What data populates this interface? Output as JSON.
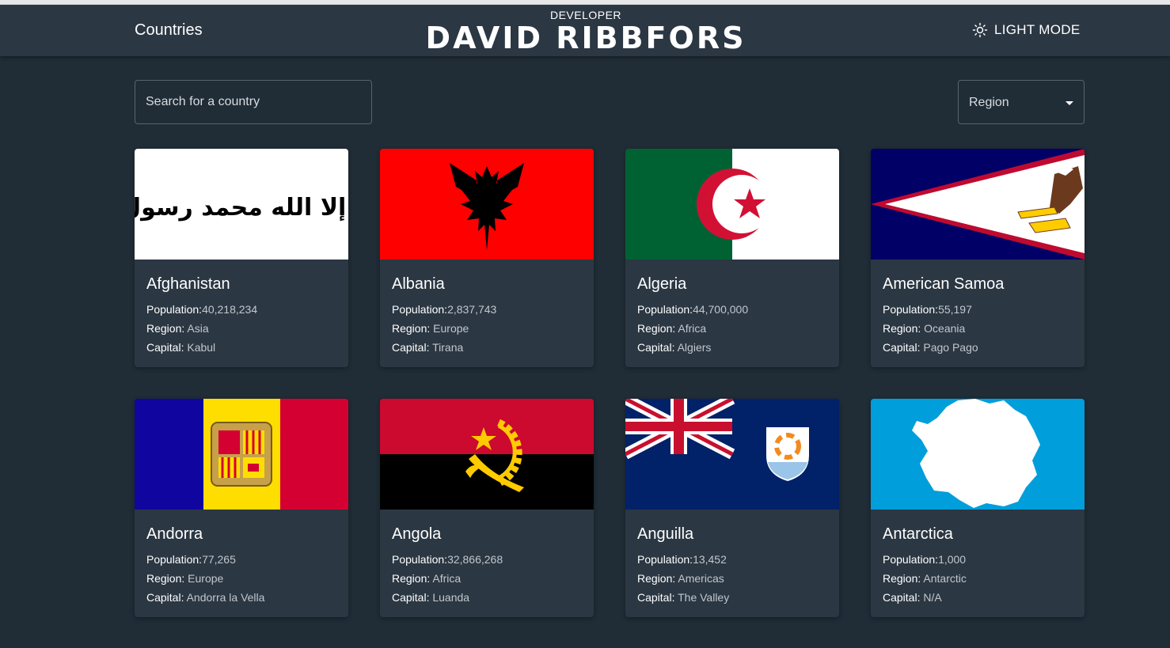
{
  "header": {
    "home_label": "Countries",
    "developer_label": "DEVELOPER",
    "developer_name": "DAVID RIBBFORS",
    "mode_label": "LIGHT MODE",
    "mode_icon": "sun-icon"
  },
  "search": {
    "placeholder": "Search for a country",
    "value": ""
  },
  "region_filter": {
    "label": "Region",
    "icon": "caret-down-icon"
  },
  "field_labels": {
    "population": "Population:",
    "region": "Region:",
    "capital": "Capital:"
  },
  "countries": [
    {
      "name": "Afghanistan",
      "population": "40,218,234",
      "region": "Asia",
      "capital": "Kabul",
      "flag_text": "لا إله إلا الله محمد رسول الله"
    },
    {
      "name": "Albania",
      "population": "2,837,743",
      "region": "Europe",
      "capital": "Tirana"
    },
    {
      "name": "Algeria",
      "population": "44,700,000",
      "region": "Africa",
      "capital": "Algiers"
    },
    {
      "name": "American Samoa",
      "population": "55,197",
      "region": "Oceania",
      "capital": "Pago Pago"
    },
    {
      "name": "Andorra",
      "population": "77,265",
      "region": "Europe",
      "capital": "Andorra la Vella"
    },
    {
      "name": "Angola",
      "population": "32,866,268",
      "region": "Africa",
      "capital": "Luanda"
    },
    {
      "name": "Anguilla",
      "population": "13,452",
      "region": "Americas",
      "capital": "The Valley"
    },
    {
      "name": "Antarctica",
      "population": "1,000",
      "region": "Antarctic",
      "capital": "N/A"
    }
  ],
  "colors": {
    "background": "#202c36",
    "elements": "#2b3743",
    "text": "#ffffff",
    "muted_text": "#c2c7cc"
  }
}
